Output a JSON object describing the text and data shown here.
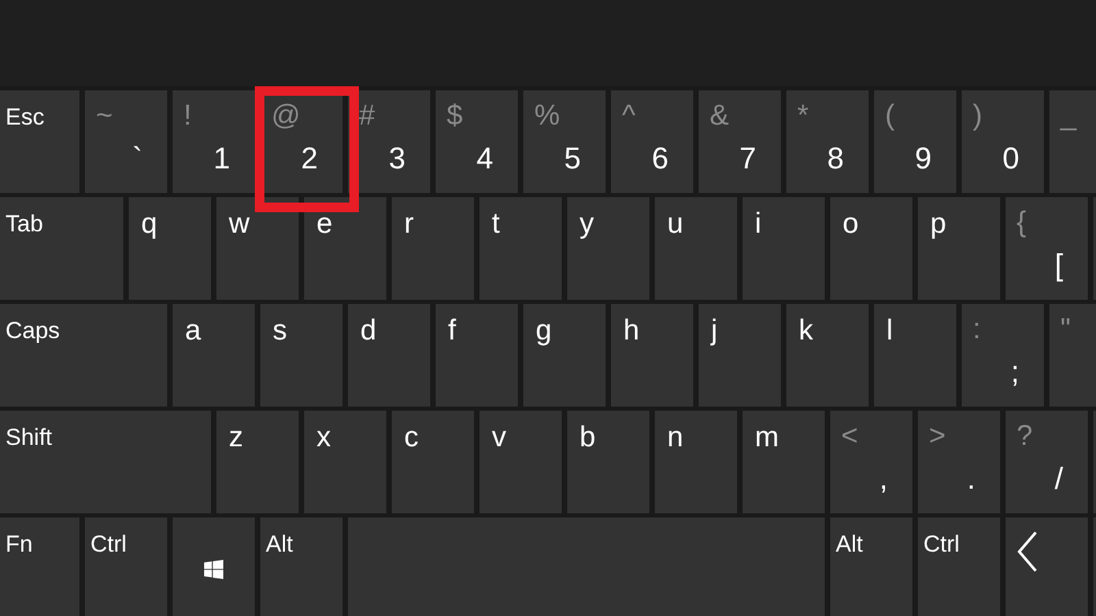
{
  "keyboard": {
    "rows": [
      [
        {
          "kind": "label",
          "label": "Esc"
        },
        {
          "kind": "pair",
          "shift": "~",
          "main": "`"
        },
        {
          "kind": "pair",
          "shift": "!",
          "main": "1"
        },
        {
          "kind": "pair",
          "shift": "@",
          "main": "2",
          "highlighted": true
        },
        {
          "kind": "pair",
          "shift": "#",
          "main": "3"
        },
        {
          "kind": "pair",
          "shift": "$",
          "main": "4"
        },
        {
          "kind": "pair",
          "shift": "%",
          "main": "5"
        },
        {
          "kind": "pair",
          "shift": "^",
          "main": "6"
        },
        {
          "kind": "pair",
          "shift": "&",
          "main": "7"
        },
        {
          "kind": "pair",
          "shift": "*",
          "main": "8"
        },
        {
          "kind": "pair",
          "shift": "(",
          "main": "9"
        },
        {
          "kind": "pair",
          "shift": ")",
          "main": "0"
        },
        {
          "kind": "pair",
          "shift": "_"
        }
      ],
      [
        {
          "kind": "label",
          "label": "Tab"
        },
        {
          "kind": "letter",
          "label": "q"
        },
        {
          "kind": "letter",
          "label": "w"
        },
        {
          "kind": "letter",
          "label": "e"
        },
        {
          "kind": "letter",
          "label": "r"
        },
        {
          "kind": "letter",
          "label": "t"
        },
        {
          "kind": "letter",
          "label": "y"
        },
        {
          "kind": "letter",
          "label": "u"
        },
        {
          "kind": "letter",
          "label": "i"
        },
        {
          "kind": "letter",
          "label": "o"
        },
        {
          "kind": "letter",
          "label": "p"
        },
        {
          "kind": "pair",
          "shift": "{",
          "main": "["
        },
        {
          "kind": "blank"
        }
      ],
      [
        {
          "kind": "label",
          "label": "Caps"
        },
        {
          "kind": "letter",
          "label": "a"
        },
        {
          "kind": "letter",
          "label": "s"
        },
        {
          "kind": "letter",
          "label": "d"
        },
        {
          "kind": "letter",
          "label": "f"
        },
        {
          "kind": "letter",
          "label": "g"
        },
        {
          "kind": "letter",
          "label": "h"
        },
        {
          "kind": "letter",
          "label": "j"
        },
        {
          "kind": "letter",
          "label": "k"
        },
        {
          "kind": "letter",
          "label": "l"
        },
        {
          "kind": "pair",
          "shift": ":",
          "main": ";"
        },
        {
          "kind": "pair",
          "shift": "\""
        }
      ],
      [
        {
          "kind": "label",
          "label": "Shift"
        },
        {
          "kind": "letter",
          "label": "z"
        },
        {
          "kind": "letter",
          "label": "x"
        },
        {
          "kind": "letter",
          "label": "c"
        },
        {
          "kind": "letter",
          "label": "v"
        },
        {
          "kind": "letter",
          "label": "b"
        },
        {
          "kind": "letter",
          "label": "n"
        },
        {
          "kind": "letter",
          "label": "m"
        },
        {
          "kind": "pair",
          "shift": "<",
          "main": ","
        },
        {
          "kind": "pair",
          "shift": ">",
          "main": "."
        },
        {
          "kind": "pair",
          "shift": "?",
          "main": "/"
        },
        {
          "kind": "blank"
        }
      ],
      [
        {
          "kind": "label",
          "label": "Fn"
        },
        {
          "kind": "label",
          "label": "Ctrl"
        },
        {
          "kind": "windows"
        },
        {
          "kind": "label",
          "label": "Alt"
        },
        {
          "kind": "space"
        },
        {
          "kind": "label",
          "label": "Alt"
        },
        {
          "kind": "label",
          "label": "Ctrl"
        },
        {
          "kind": "back"
        },
        {
          "kind": "blank"
        }
      ]
    ]
  }
}
